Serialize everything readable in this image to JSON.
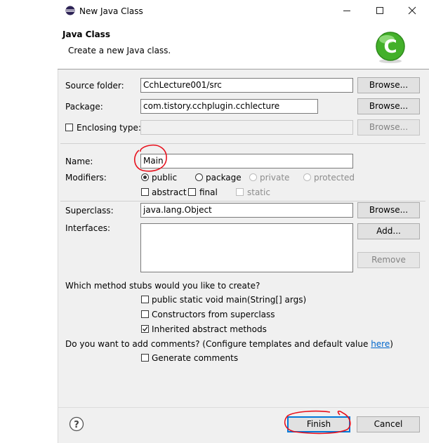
{
  "window": {
    "title": "New Java Class",
    "minimize_icon": "minimize-icon",
    "maximize_icon": "maximize-icon",
    "close_icon": "close-icon"
  },
  "header": {
    "title": "Java Class",
    "subtitle": "Create a new Java class.",
    "logo_letter": "C",
    "logo_color": "#43b02a"
  },
  "form": {
    "source_folder": {
      "label": "Source folder:",
      "value": "CchLecture001/src",
      "browse": "Browse..."
    },
    "package": {
      "label": "Package:",
      "value": "com.tistory.cchplugin.cchlecture",
      "browse": "Browse..."
    },
    "enclosing": {
      "label": "Enclosing type:",
      "value": "",
      "browse": "Browse...",
      "checked": false
    },
    "name": {
      "label": "Name:",
      "value": "Main"
    },
    "modifiers": {
      "label": "Modifiers:",
      "radios": [
        "public",
        "package",
        "private",
        "protected"
      ],
      "selected": "public",
      "checks": [
        "abstract",
        "final",
        "static"
      ]
    },
    "superclass": {
      "label": "Superclass:",
      "value": "java.lang.Object",
      "browse": "Browse..."
    },
    "interfaces": {
      "label": "Interfaces:",
      "add": "Add...",
      "remove": "Remove"
    },
    "stubs": {
      "question": "Which method stubs would you like to create?",
      "main": "public static void main(String[] args)",
      "constructors": "Constructors from superclass",
      "inherited": "Inherited abstract methods"
    },
    "comments": {
      "question_prefix": "Do you want to add comments? (Configure templates and default value ",
      "link": "here",
      "question_suffix": ")",
      "generate": "Generate comments"
    }
  },
  "footer": {
    "help_icon": "help-icon",
    "finish": "Finish",
    "cancel": "Cancel"
  },
  "annotation_color": "#e8101c"
}
